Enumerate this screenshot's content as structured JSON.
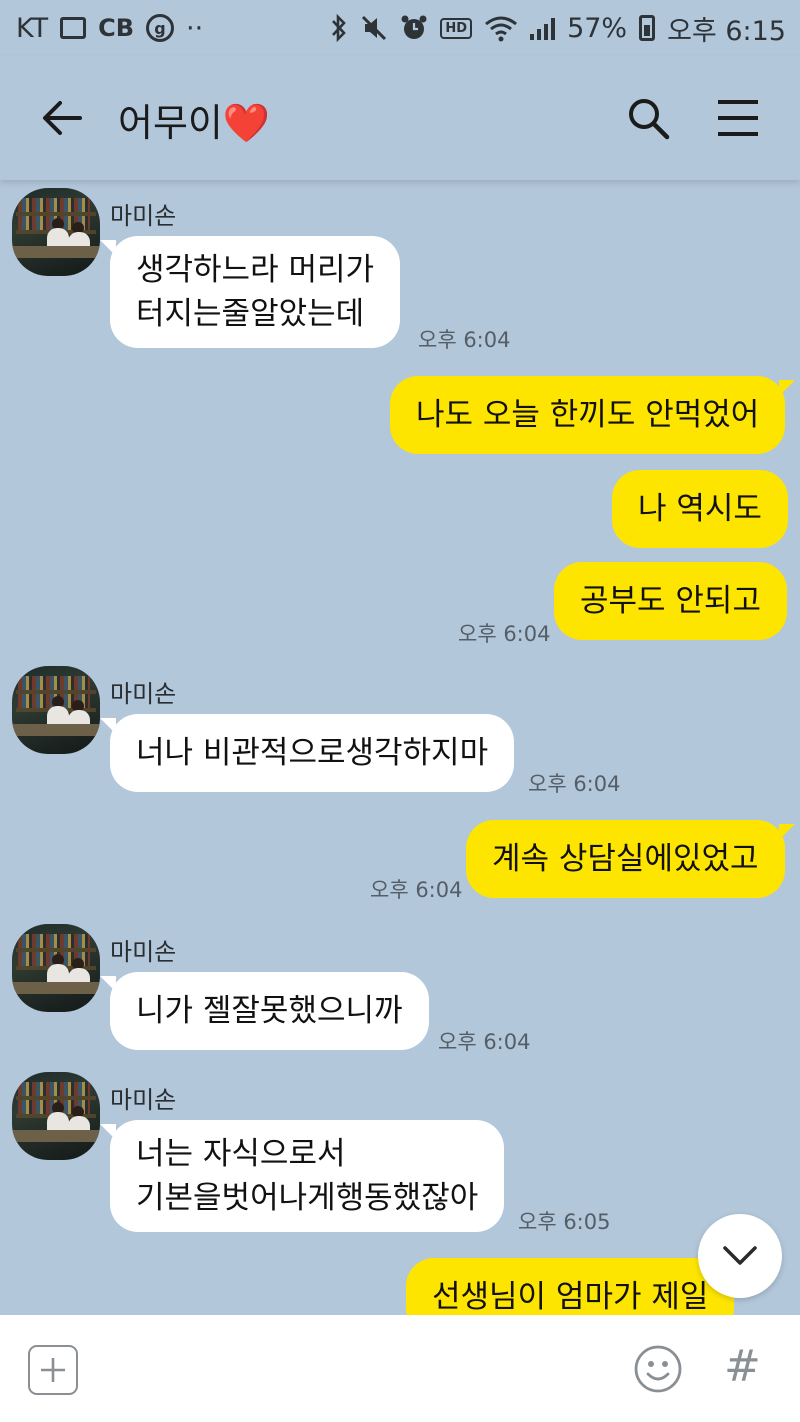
{
  "status_bar": {
    "carrier": "KT",
    "cb_label": "CB",
    "g_label": "g",
    "dots": "··",
    "hd_label": "HD",
    "battery": "57%",
    "time": "오후 6:15"
  },
  "header": {
    "title": "어무이",
    "title_emoji": "❤️"
  },
  "messages": [
    {
      "dir": "in",
      "sender": "마미손",
      "text": "생각하느라 머리가\n터지는줄알았는데",
      "time": "오후 6:04"
    },
    {
      "dir": "out",
      "text": "나도 오늘 한끼도 안먹었어"
    },
    {
      "dir": "out",
      "text": "나 역시도"
    },
    {
      "dir": "out",
      "text": "공부도 안되고",
      "time": "오후 6:04"
    },
    {
      "dir": "in",
      "sender": "마미손",
      "text": "너나 비관적으로생각하지마",
      "time": "오후 6:04"
    },
    {
      "dir": "out",
      "text": "계속 상담실에있었고",
      "time": "오후 6:04"
    },
    {
      "dir": "in",
      "sender": "마미손",
      "text": "니가 젤잘못했으니까",
      "time": "오후 6:04"
    },
    {
      "dir": "in",
      "sender": "마미손",
      "text": "너는 자식으로서\n기본을벗어나게행동했잖아",
      "time": "오후 6:05"
    },
    {
      "dir": "out",
      "text": "선생님이 엄마가 제일"
    }
  ],
  "input_bar": {
    "hash_label": "#"
  },
  "colors": {
    "chat_bg": "#b2c7da",
    "outgoing_bubble": "#fee500",
    "incoming_bubble": "#ffffff"
  }
}
